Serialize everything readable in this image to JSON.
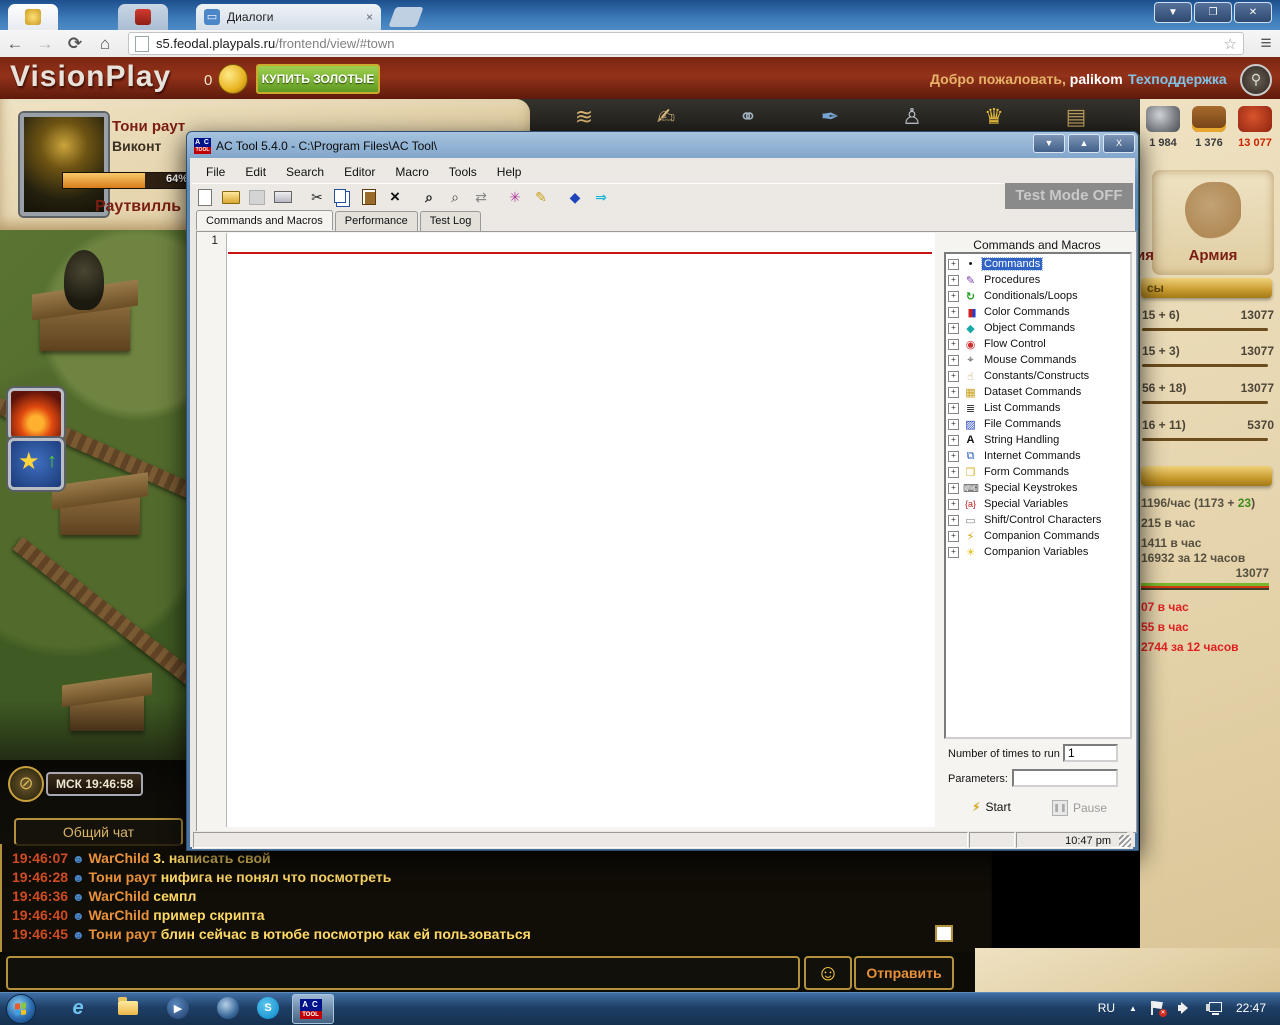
{
  "browser": {
    "tabs": [
      {
        "name": "pinned-tab-1",
        "icon": "coin-emblem"
      },
      {
        "name": "pinned-tab-2",
        "icon": "red-shield"
      },
      {
        "name": "dialogs-tab",
        "label": "Диалоги",
        "close": "×",
        "icon": "chat-bubble"
      }
    ],
    "controls": {
      "back": "←",
      "forward": "→",
      "refresh": "⟳",
      "home": "⌂",
      "menu": "≡",
      "star": "☆"
    },
    "window_buttons": {
      "minimize": "▼",
      "restore": "❐",
      "close": "✕"
    },
    "url": {
      "domain": "s5.feodal.playpals.ru",
      "path": "/frontend/view/#town"
    }
  },
  "game": {
    "brand": "VisionPlay",
    "gold_amount": "0",
    "buy_gold_label": "КУПИТЬ ЗОЛОТЫЕ",
    "welcome_prefix": "Добро пожаловать,",
    "username": "palikom",
    "support_link": "Техподдержка",
    "player": {
      "name": "Тони раут",
      "title": "Виконт",
      "progress": "64%",
      "town": "Раутвилль"
    },
    "resources": [
      {
        "name": "stone",
        "value": "1 984"
      },
      {
        "name": "treasure",
        "value": "1 376"
      },
      {
        "name": "food",
        "value": "13 077",
        "alert": true
      }
    ],
    "army_label": "Армия",
    "army_label_fragment": "ия",
    "sidebar": {
      "ribbon_fragment": "сы",
      "rows": [
        {
          "left": "15 + 6)",
          "value": "13077"
        },
        {
          "left": "15 + 3)",
          "value": "13077"
        },
        {
          "left": "56 + 18)",
          "value": "13077"
        },
        {
          "left": "16 + 11)",
          "value": "5370"
        }
      ],
      "income": {
        "rate_main": "1196/час (1173 + ",
        "rate_green": "23",
        "rate_close": ")",
        "line2": "215 в час",
        "line3": "1411 в час",
        "line4": "16932 за 12 часов",
        "total": "13077"
      },
      "red_lines": [
        "07 в час",
        "55 в час",
        "2744 за 12 часов"
      ]
    },
    "clock_badge": "МСК 19:46:58",
    "chat": {
      "tab_label": "Общий чат",
      "messages": [
        {
          "time": "19:46:07",
          "user": "WarChild",
          "text": "3. написать свой"
        },
        {
          "time": "19:46:28",
          "user": "Тони раут",
          "text": "нифига не понял что посмотреть"
        },
        {
          "time": "19:46:36",
          "user": "WarChild",
          "text": "семпл"
        },
        {
          "time": "19:46:40",
          "user": "WarChild",
          "text": "пример скрипта"
        },
        {
          "time": "19:46:45",
          "user": "Тони раут",
          "text": "блин сейчас в ютюбе посмотрю как ей пользоваться"
        }
      ],
      "send_label": "Отправить",
      "smiley": "☺"
    }
  },
  "actool": {
    "title": "AC Tool 5.4.0 - C:\\Program Files\\AC Tool\\",
    "logo_top": "A C",
    "logo_bottom": "TOOL",
    "window_buttons": {
      "minimize": "▼",
      "maximize": "▲",
      "close": "X"
    },
    "menus": [
      "File",
      "Edit",
      "Search",
      "Editor",
      "Macro",
      "Tools",
      "Help"
    ],
    "toolbar_glyphs": {
      "cut": "✂",
      "delete": "×",
      "find": "⌕",
      "findnext": "⌕",
      "replace": "⇄",
      "wizard": "✳",
      "pencil": "✎",
      "help": "◆",
      "exit": "⇒"
    },
    "test_mode": "Test Mode OFF",
    "tabs": [
      "Commands and Macros",
      "Performance",
      "Test Log"
    ],
    "line_number": "1",
    "panel_title": "Commands and Macros",
    "tree": [
      {
        "label": "Commands",
        "glyph": "•",
        "selected": true
      },
      {
        "label": "Procedures",
        "glyph": "✎"
      },
      {
        "label": "Conditionals/Loops",
        "glyph": "↻"
      },
      {
        "label": "Color Commands",
        "glyph": "▮"
      },
      {
        "label": "Object Commands",
        "glyph": "◆"
      },
      {
        "label": "Flow Control",
        "glyph": "◉"
      },
      {
        "label": "Mouse Commands",
        "glyph": "⌖"
      },
      {
        "label": "Constants/Constructs",
        "glyph": "☝"
      },
      {
        "label": "Dataset Commands",
        "glyph": "▦"
      },
      {
        "label": "List Commands",
        "glyph": "≣"
      },
      {
        "label": "File Commands",
        "glyph": "▨"
      },
      {
        "label": "String Handling",
        "glyph": "A"
      },
      {
        "label": "Internet Commands",
        "glyph": "⧉"
      },
      {
        "label": "Form Commands",
        "glyph": "❐"
      },
      {
        "label": "Special Keystrokes",
        "glyph": "⌨"
      },
      {
        "label": "Special Variables",
        "glyph": "{a}"
      },
      {
        "label": "Shift/Control Characters",
        "glyph": "▭"
      },
      {
        "label": "Companion Commands",
        "glyph": "⚡"
      },
      {
        "label": "Companion Variables",
        "glyph": "☀"
      }
    ],
    "expand_glyph": "+",
    "run_label": "Number of times to run",
    "run_value": "1",
    "params_label": "Parameters:",
    "start_label": "Start",
    "pause_label": "Pause",
    "status_time": "10:47 pm"
  },
  "taskbar": {
    "icons": [
      "internet-explorer",
      "explorer-folder",
      "media-player",
      "browser-ball",
      "skype",
      "ac-tool"
    ],
    "ie_glyph": "e",
    "play_glyph": "▶",
    "skype_glyph": "S",
    "tray": {
      "lang": "RU",
      "chevron": "▲",
      "time": "22:47"
    }
  }
}
